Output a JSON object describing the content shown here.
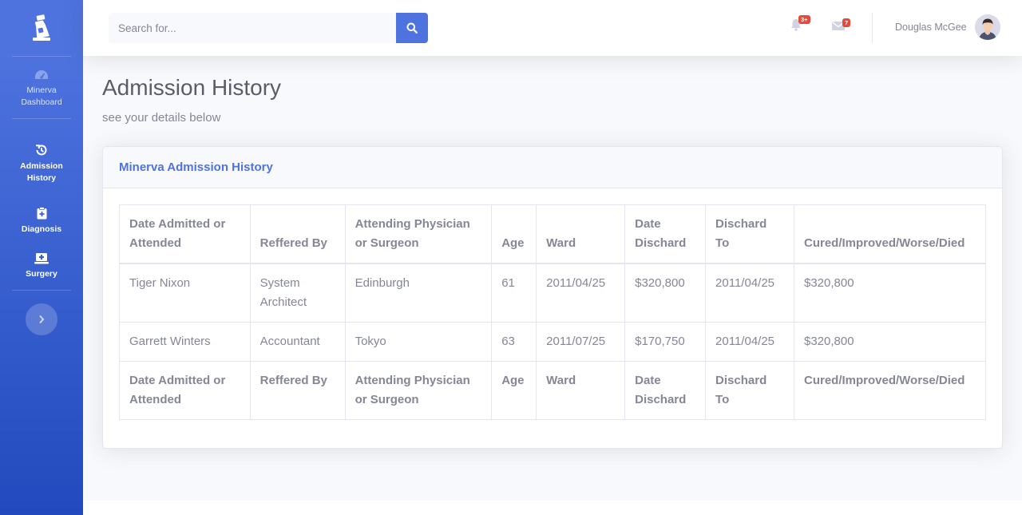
{
  "sidebar": {
    "items": [
      {
        "label_lines": [
          "Minerva",
          "Dashboard"
        ],
        "icon": "tachometer-icon"
      },
      {
        "label_lines": [
          "Admission",
          "History"
        ],
        "icon": "history-icon"
      },
      {
        "label_lines": [
          "Diagnosis"
        ],
        "icon": "clipboard-medical-icon"
      },
      {
        "label_lines": [
          "Surgery"
        ],
        "icon": "laptop-medical-icon"
      }
    ],
    "brand_icon": "medical-bottle-icon",
    "toggle_icon": "chevron-right-icon"
  },
  "topbar": {
    "search_placeholder": "Search for...",
    "alerts_badge": "3+",
    "messages_badge": "7",
    "user_name": "Douglas McGee"
  },
  "page": {
    "title": "Admission History",
    "subtitle": "see your details below"
  },
  "card": {
    "title": "Minerva Admission History"
  },
  "table": {
    "headers": [
      [
        "Date Admitted or",
        "Attended"
      ],
      [
        "Reffered By"
      ],
      [
        "Attending Physician",
        "or Surgeon"
      ],
      [
        "Age"
      ],
      [
        "Ward"
      ],
      [
        "Date",
        "Dischard"
      ],
      [
        "Dischard",
        "To"
      ],
      [
        "Cured/Improved/Worse/Died"
      ]
    ],
    "rows": [
      [
        [
          "Tiger Nixon"
        ],
        [
          "System",
          "Architect"
        ],
        [
          "Edinburgh"
        ],
        [
          "61"
        ],
        [
          "2011/04/25"
        ],
        [
          "$320,800"
        ],
        [
          "2011/04/25"
        ],
        [
          "$320,800"
        ]
      ],
      [
        [
          "Garrett Winters"
        ],
        [
          "Accountant"
        ],
        [
          "Tokyo"
        ],
        [
          "63"
        ],
        [
          "2011/07/25"
        ],
        [
          "$170,750"
        ],
        [
          "2011/04/25"
        ],
        [
          "$320,800"
        ]
      ]
    ]
  },
  "colors": {
    "primary": "#4e73df",
    "sidebar_gradient_end": "#224abe",
    "danger": "#e74a3b",
    "text_gray": "#858796"
  }
}
